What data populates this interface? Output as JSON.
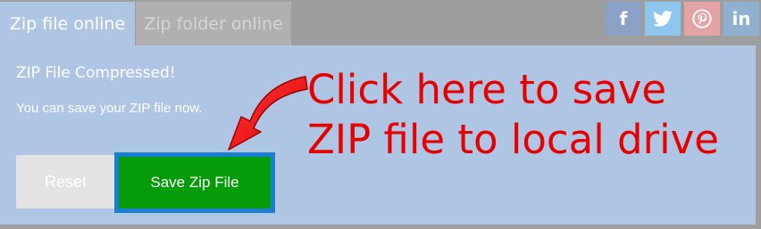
{
  "tabs": [
    {
      "label": "Zip file online",
      "active": true
    },
    {
      "label": "Zip folder online",
      "active": false
    }
  ],
  "social": [
    {
      "glyph": "f",
      "icon": "facebook-icon",
      "color": "#8aa2c7"
    },
    {
      "glyph": "",
      "icon": "twitter-icon",
      "color": "#8fc6ee"
    },
    {
      "glyph": "",
      "icon": "pinterest-icon",
      "color": "#e4a3a5"
    },
    {
      "glyph": "in",
      "icon": "linkedin-icon",
      "color": "#8fb1cf"
    }
  ],
  "panel": {
    "title": "ZIP File Compressed!",
    "subtitle": "You can save your ZIP file now."
  },
  "buttons": {
    "reset_label": "Reset",
    "save_label": "Save Zip File"
  },
  "callout": {
    "line1": "Click here to save",
    "line2": "ZIP file to local drive",
    "color": "#e60000"
  },
  "colors": {
    "panel_bg": "#aec5e3",
    "save_bg": "#069b08",
    "save_outline": "#1a7fd0",
    "reset_bg": "#e3e3e3"
  }
}
